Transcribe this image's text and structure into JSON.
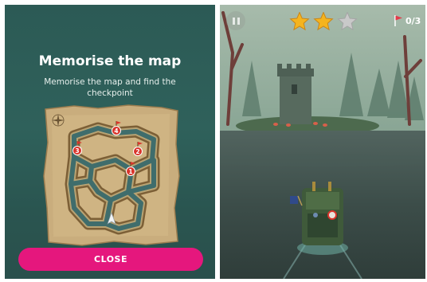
{
  "memorise_panel": {
    "title": "Memorise the map",
    "subtitle": "Memorise the map and find the checkpoint",
    "close_label": "CLOSE",
    "checkpoint_numbers": [
      "4",
      "3",
      "2",
      "1"
    ],
    "icons": [
      "compass-rose-icon",
      "boat-arrow-icon",
      "checkpoint-flag-icon"
    ],
    "colors": {
      "close_button": "#e5177d",
      "checkpoint_marker": "#d9342b",
      "background": "#2e5e59"
    }
  },
  "game_hud": {
    "stars_earned": 2,
    "stars_total": 3,
    "flags_collected": "0/3",
    "icons": [
      "pause-icon",
      "star-icon",
      "red-flag-icon"
    ],
    "colors": {
      "star_gold": "#f5b41e",
      "star_empty": "#c9c9c9",
      "flag": "#e23b4a"
    }
  }
}
